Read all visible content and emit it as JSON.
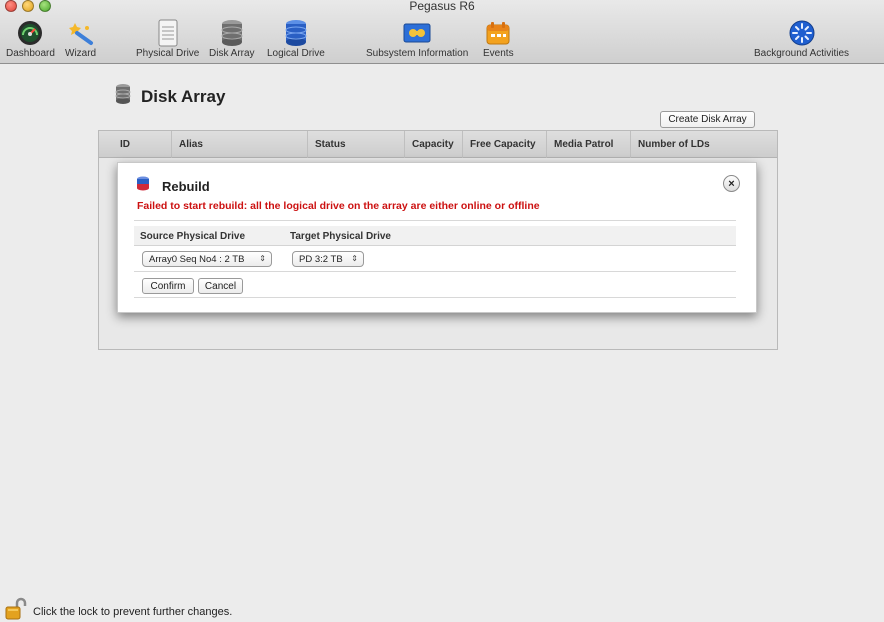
{
  "window": {
    "title": "Pegasus R6"
  },
  "toolbar": {
    "dashboard": "Dashboard",
    "wizard": "Wizard",
    "physical_drive": "Physical Drive",
    "disk_array": "Disk Array",
    "logical_drive": "Logical Drive",
    "subsystem_information": "Subsystem Information",
    "events": "Events",
    "background_activities": "Background Activities"
  },
  "page": {
    "title": "Disk Array",
    "create_button": "Create Disk Array",
    "columns": [
      "ID",
      "Alias",
      "Status",
      "Capacity",
      "Free Capacity",
      "Media Patrol",
      "Number of LDs"
    ]
  },
  "dialog": {
    "title": "Rebuild",
    "error": "Failed to start rebuild: all the logical drive on the array are either online or offline",
    "source_header": "Source Physical Drive",
    "target_header": "Target Physical Drive",
    "source_value": "Array0 Seq No4 : 2 TB",
    "target_value": "PD 3:2 TB",
    "confirm": "Confirm",
    "cancel": "Cancel"
  },
  "status": {
    "text": "Click the lock to prevent further changes."
  },
  "icons": {
    "dashboard": "dashboard-gauge-icon",
    "wizard": "wizard-wand-icon",
    "physical_drive": "physical-drive-icon",
    "disk_array": "disk-array-icon",
    "logical_drive": "logical-drive-icon",
    "subsystem": "subsystem-information-icon",
    "events": "events-calendar-icon",
    "background": "background-activities-icon",
    "lock": "lock-open-icon",
    "close": "close-icon"
  },
  "colors": {
    "error": "#cc1111",
    "accent": "#2a6bd6"
  }
}
